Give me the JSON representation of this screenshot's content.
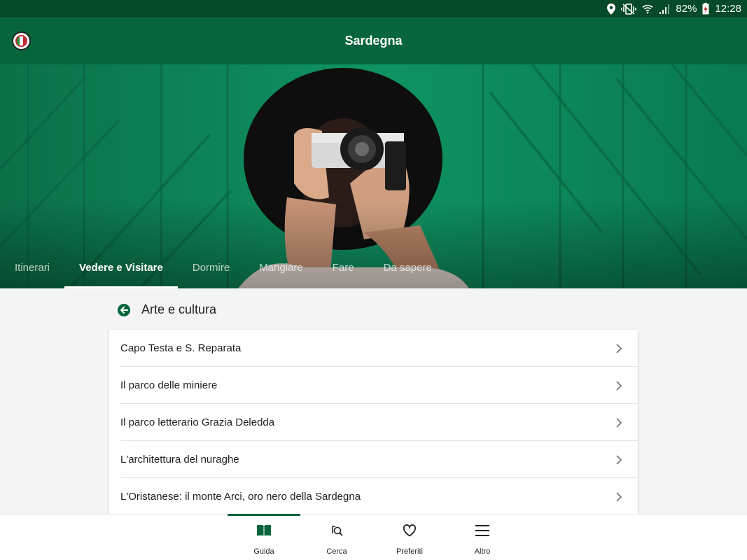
{
  "status_bar": {
    "battery": "82%",
    "time": "12:28",
    "icons": [
      "location-icon",
      "vibrate-icon",
      "wifi-icon",
      "signal-icon",
      "battery-icon"
    ]
  },
  "app_bar": {
    "title": "Sardegna",
    "logo_icon": "app-logo-icon"
  },
  "tabs": [
    {
      "label": "Itinerari",
      "active": false
    },
    {
      "label": "Vedere e Visitare",
      "active": true
    },
    {
      "label": "Dormire",
      "active": false
    },
    {
      "label": "Mangiare",
      "active": false
    },
    {
      "label": "Fare",
      "active": false
    },
    {
      "label": "Da sapere",
      "active": false
    }
  ],
  "section": {
    "back_icon": "back-arrow-icon",
    "title": "Arte e cultura"
  },
  "list": [
    {
      "label": "Capo Testa e S. Reparata"
    },
    {
      "label": "Il parco delle miniere"
    },
    {
      "label": "Il parco letterario Grazia Deledda"
    },
    {
      "label": "L'architettura del nuraghe"
    },
    {
      "label": "L'Oristanese: il monte Arci, oro nero della Sardegna"
    }
  ],
  "bottom_nav": [
    {
      "label": "Guida",
      "icon": "book-icon",
      "active": true
    },
    {
      "label": "Cerca",
      "icon": "search-icon",
      "active": false
    },
    {
      "label": "Preferiti",
      "icon": "heart-icon",
      "active": false
    },
    {
      "label": "Altro",
      "icon": "menu-icon",
      "active": false
    }
  ],
  "colors": {
    "status_bar": "#044a28",
    "app_bar": "#06653c",
    "accent": "#06653c",
    "background": "#f4f4f4"
  }
}
